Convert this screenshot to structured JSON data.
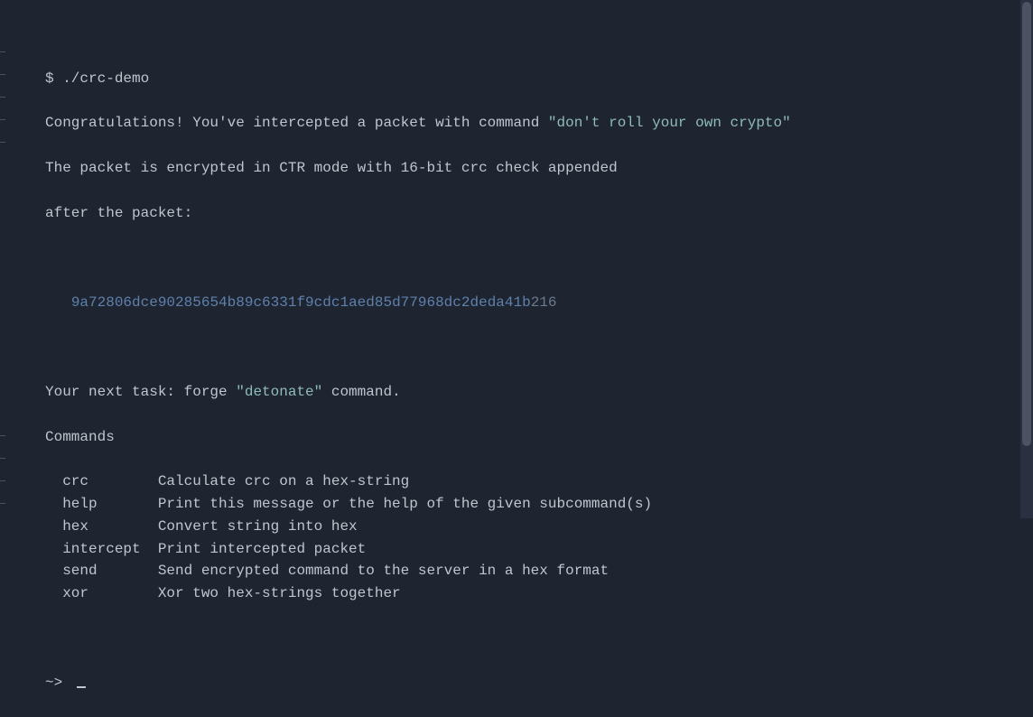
{
  "tick_positions": [
    57,
    82,
    107,
    132,
    157,
    482,
    507,
    532,
    557
  ],
  "shell_prompt": "$ ",
  "command_run": "./crc-demo",
  "msg_congrats_pre": "Congratulations! You've intercepted a packet with command ",
  "quoted_known_cmd": "\"don't roll your own crypto\"",
  "msg_line2": "The packet is encrypted in CTR mode with 16-bit crc check appended",
  "msg_line3": "after the packet:",
  "hex_prefix_spaces": "   ",
  "hex_main": "9a72806dce90285654b89c6331f9cdc1aed85d77968dc2deda41b",
  "hex_suffix": "216",
  "task_pre": "Your next task: forge ",
  "quoted_forge_cmd": "\"detonate\"",
  "task_post": " command.",
  "commands_header": "Commands",
  "commands": [
    {
      "name": "crc",
      "desc": "Calculate crc on a hex-string"
    },
    {
      "name": "help",
      "desc": "Print this message or the help of the given subcommand(s)"
    },
    {
      "name": "hex",
      "desc": "Convert string into hex"
    },
    {
      "name": "intercept",
      "desc": "Print intercepted packet"
    },
    {
      "name": "send",
      "desc": "Send encrypted command to the server in a hex format"
    },
    {
      "name": "xor",
      "desc": "Xor two hex-strings together"
    }
  ],
  "interactive_prompt": "~> "
}
